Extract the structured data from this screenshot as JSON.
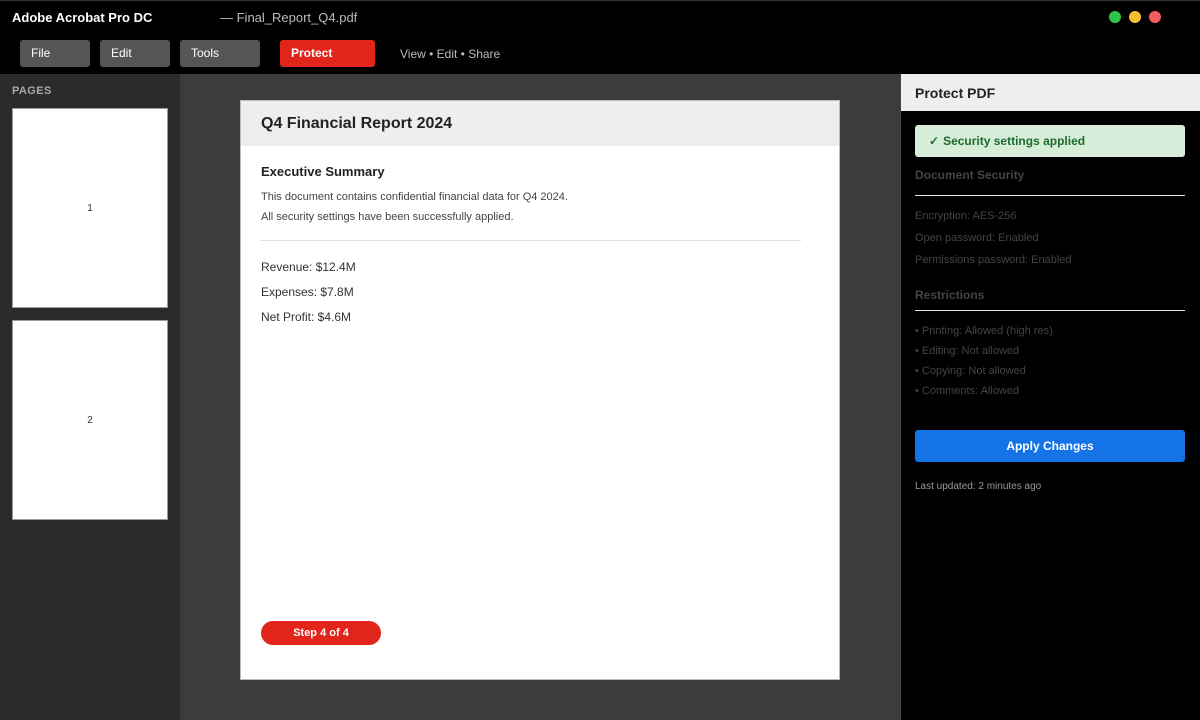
{
  "window": {
    "app_title": "Adobe Acrobat Pro DC",
    "document_title": "— Final_Report_Q4.pdf",
    "controls": {
      "minimize_color": "#2dc447",
      "maximize_color": "#f5bf2f",
      "close_color": "#f25c5c"
    }
  },
  "toolbar": {
    "file_label": "File",
    "edit_label": "Edit",
    "tools_label": "Tools",
    "protect_label": "Protect",
    "hint": "View • Edit • Share"
  },
  "pages_panel": {
    "title": "PAGES",
    "thumbnails": [
      {
        "label": "1"
      },
      {
        "label": "2"
      }
    ]
  },
  "document": {
    "title": "Q4 Financial Report 2024",
    "section_heading": "Executive Summary",
    "lines": [
      "This document contains confidential financial data for Q4 2024.",
      "All security settings have been successfully applied."
    ],
    "figures": [
      "Revenue: $12.4M",
      "Expenses: $7.8M",
      "Net Profit: $4.6M"
    ],
    "step_badge": "Step 4 of 4"
  },
  "protect_panel": {
    "title": "Protect PDF",
    "success_icon": "✓",
    "success_message": "Security settings applied",
    "security_heading": "Document Security",
    "security_items": [
      "Encryption: AES-256",
      "Open password: Enabled",
      "Permissions password: Enabled"
    ],
    "restrictions_heading": "Restrictions",
    "restrictions_items": [
      "• Printing: Allowed (high res)",
      "• Editing: Not allowed",
      "• Copying: Not allowed",
      "• Comments: Allowed"
    ],
    "apply_label": "Apply Changes",
    "last_updated": "Last updated: 2 minutes ago"
  },
  "colors": {
    "accent_red": "#e1251b",
    "accent_blue": "#1473e6",
    "success_bg": "#d6edd9",
    "success_text": "#1e6b2e"
  }
}
